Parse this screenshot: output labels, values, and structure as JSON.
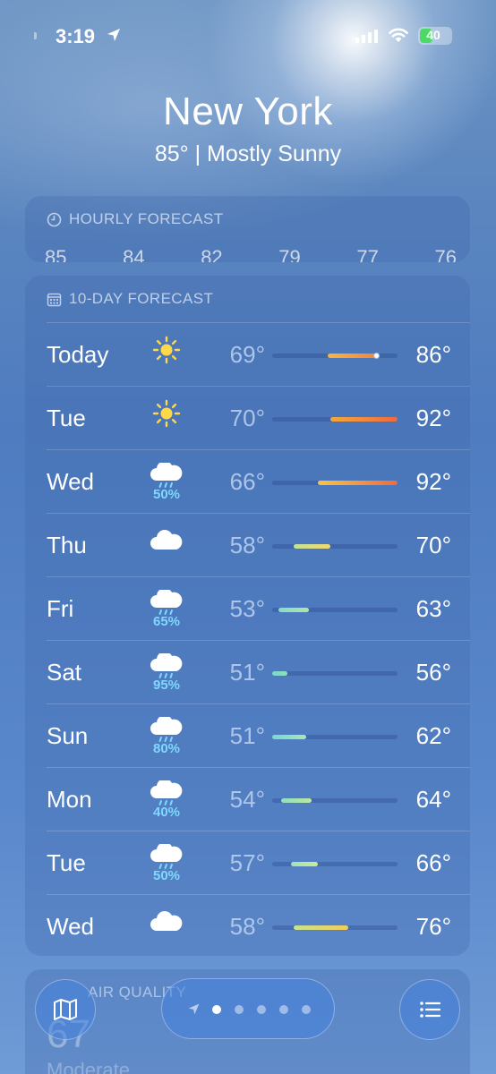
{
  "status_bar": {
    "time": "3:19",
    "battery": "40",
    "battery_level": 0.4,
    "battery_color": "#4cd964",
    "icons": [
      "location-arrow-icon",
      "cellular-signal-icon",
      "wifi-icon",
      "battery-icon"
    ]
  },
  "header": {
    "city": "New York",
    "summary": "85°  |  Mostly Sunny"
  },
  "hourly": {
    "title": "HOURLY FORECAST",
    "icon": "clock-icon",
    "peek": [
      "85",
      "84",
      "82",
      "79",
      "77",
      "76"
    ]
  },
  "ten_day": {
    "title": "10-DAY FORECAST",
    "icon": "calendar-icon",
    "range": [
      51,
      92
    ],
    "rows": [
      {
        "day": "Today",
        "icon": "sun-icon",
        "precip": "",
        "low": "69°",
        "high": "86°",
        "low_val": 69,
        "high_val": 86,
        "current_val": 85,
        "color_from": "#f5b642",
        "color_to": "#f0823c"
      },
      {
        "day": "Tue",
        "icon": "sun-icon",
        "precip": "",
        "low": "70°",
        "high": "92°",
        "low_val": 70,
        "high_val": 92,
        "color_from": "#f4a83a",
        "color_to": "#ef6a3f"
      },
      {
        "day": "Wed",
        "icon": "rain-cloud-icon",
        "precip": "50%",
        "low": "66°",
        "high": "92°",
        "low_val": 66,
        "high_val": 92,
        "color_from": "#f7c445",
        "color_to": "#ef6a3f"
      },
      {
        "day": "Thu",
        "icon": "cloud-icon",
        "precip": "",
        "low": "58°",
        "high": "70°",
        "low_val": 58,
        "high_val": 70,
        "color_from": "#bfe39a",
        "color_to": "#f1d771"
      },
      {
        "day": "Fri",
        "icon": "rain-cloud-icon",
        "precip": "65%",
        "low": "53°",
        "high": "63°",
        "low_val": 53,
        "high_val": 63,
        "color_from": "#86dcc4",
        "color_to": "#b2e6a3"
      },
      {
        "day": "Sat",
        "icon": "rain-cloud-icon",
        "precip": "95%",
        "low": "51°",
        "high": "56°",
        "low_val": 51,
        "high_val": 56,
        "color_from": "#78d8cf",
        "color_to": "#8fe0c0"
      },
      {
        "day": "Sun",
        "icon": "rain-cloud-icon",
        "precip": "80%",
        "low": "51°",
        "high": "62°",
        "low_val": 51,
        "high_val": 62,
        "color_from": "#78d8cf",
        "color_to": "#a9e6b4"
      },
      {
        "day": "Mon",
        "icon": "rain-cloud-icon",
        "precip": "40%",
        "low": "54°",
        "high": "64°",
        "low_val": 54,
        "high_val": 64,
        "color_from": "#8ddfc4",
        "color_to": "#bde8a0"
      },
      {
        "day": "Tue",
        "icon": "rain-cloud-icon",
        "precip": "50%",
        "low": "57°",
        "high": "66°",
        "low_val": 57,
        "high_val": 66,
        "color_from": "#a3e3b4",
        "color_to": "#cfe995"
      },
      {
        "day": "Wed",
        "icon": "cloud-icon",
        "precip": "",
        "low": "58°",
        "high": "76°",
        "low_val": 58,
        "high_val": 76,
        "color_from": "#c6e48f",
        "color_to": "#f2cc5c"
      }
    ]
  },
  "air_quality": {
    "title": "AIR QUALITY",
    "value": "67",
    "label": "Moderate"
  },
  "bottom_bar": {
    "map_icon": "map-icon",
    "list_icon": "list-icon",
    "page_count": 5,
    "active_page": 0
  }
}
